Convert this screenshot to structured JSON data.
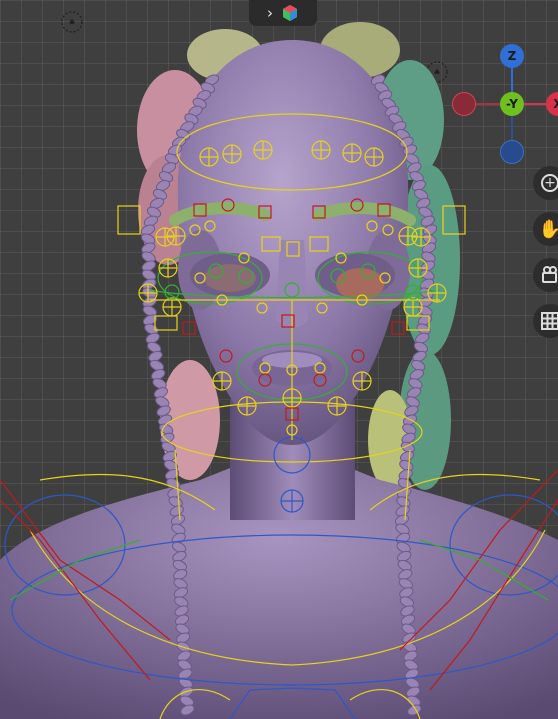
{
  "header": {
    "expand_glyph": "›",
    "editor_icon": "blender-editor-type-icon"
  },
  "gizmo": {
    "z_label": "Z",
    "y_label": "-Y",
    "x_label": "X",
    "colors": {
      "z": "#2f6fd6",
      "y": "#6fbf1f",
      "x": "#d6334a"
    }
  },
  "toolbar": {
    "zoom_icon": "zoom-plus-icon",
    "pan_icon": "hand-pan-icon",
    "camera_icon": "camera-view-icon",
    "ortho_icon": "grid-ortho-icon"
  },
  "viewport": {
    "background": "#3f3f3f",
    "object_color": "#8e7aa8",
    "rig_colors": {
      "bones_yellow": "#e8d21a",
      "bones_green": "#33b033",
      "bones_red": "#c11a1a",
      "bones_blue": "#2d58c8"
    }
  }
}
